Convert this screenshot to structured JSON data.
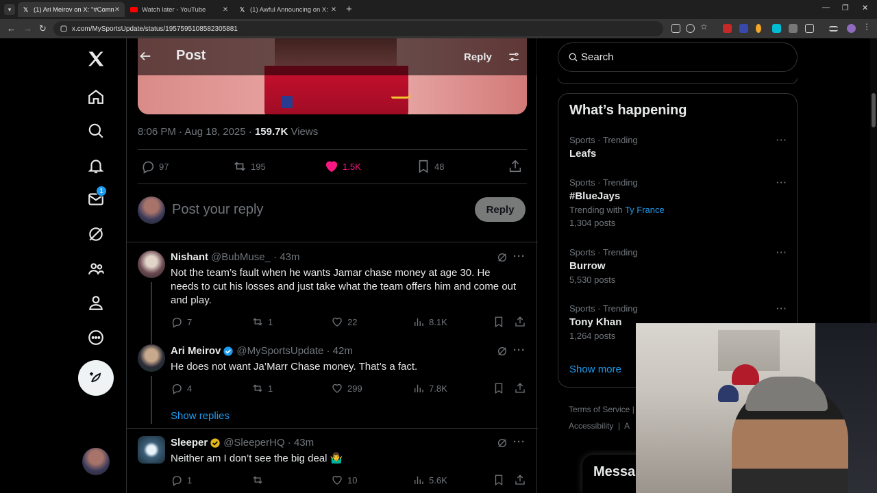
{
  "browser": {
    "tabs": [
      {
        "title": "(1) Ari Meirov on X: \"#Comman",
        "favicon": "x-icon",
        "active": true
      },
      {
        "title": "Watch later - YouTube",
        "favicon": "youtube-icon",
        "active": false
      },
      {
        "title": "(1) Awful Announcing on X: \"",
        "favicon": "x-icon",
        "active": false
      }
    ],
    "url": "x.com/MySportsUpdate/status/1957595108582305881"
  },
  "leftnav": {
    "messages_badge": "1"
  },
  "header": {
    "title": "Post",
    "reply_label": "Reply"
  },
  "post": {
    "time": "8:06 PM · Aug 18, 2025 · ",
    "views_count": "159.7K",
    "views_label": " Views",
    "replies": "97",
    "reposts": "195",
    "likes": "1.5K",
    "bookmarks": "48",
    "liked_color": "#f91880"
  },
  "composer": {
    "placeholder": "Post your reply",
    "button": "Reply"
  },
  "replies": [
    {
      "name": "Nishant",
      "handle": "@BubMuse_ · 43m",
      "text": "Not the team’s fault when he wants Jamar chase money at age 30. He needs to cut his losses and just take what the team offers him and come out and play.",
      "replies": "7",
      "reposts": "1",
      "likes": "22",
      "views": "8.1K"
    },
    {
      "name": "Ari Meirov",
      "handle": "@MySportsUpdate · 42m",
      "text": "He does not want Ja’Marr Chase money. That’s a fact.",
      "replies": "4",
      "reposts": "1",
      "likes": "299",
      "views": "7.8K"
    },
    {
      "name": "Sleeper",
      "handle": "@SleeperHQ · 43m",
      "text": "Neither am I don’t see the big deal 🤷‍♂️",
      "replies": "1",
      "reposts": "",
      "likes": "10",
      "views": "5.6K"
    }
  ],
  "show_replies": "Show replies",
  "search_placeholder": "Search",
  "happening": {
    "title": "What’s happening",
    "trends": [
      {
        "category": "Sports · Trending",
        "name": "Leafs",
        "sub_prefix": "",
        "sub_link": "",
        "posts": ""
      },
      {
        "category": "Sports · Trending",
        "name": "#BlueJays",
        "sub_prefix": "Trending with ",
        "sub_link": "Ty France",
        "posts": "1,304 posts"
      },
      {
        "category": "Sports · Trending",
        "name": "Burrow",
        "sub_prefix": "",
        "sub_link": "",
        "posts": "5,530 posts"
      },
      {
        "category": "Sports · Trending",
        "name": "Tony Khan",
        "sub_prefix": "",
        "sub_link": "",
        "posts": "1,264 posts"
      }
    ],
    "show_more": "Show more"
  },
  "footer": {
    "terms": "Terms of Service",
    "accessibility": "Accessibility",
    "sep": "|",
    "ad_fragment": "A"
  },
  "messages_drawer": "Messa",
  "colors": {
    "accent": "#1d9bf0",
    "like": "#f91880",
    "border": "#2f3336"
  }
}
